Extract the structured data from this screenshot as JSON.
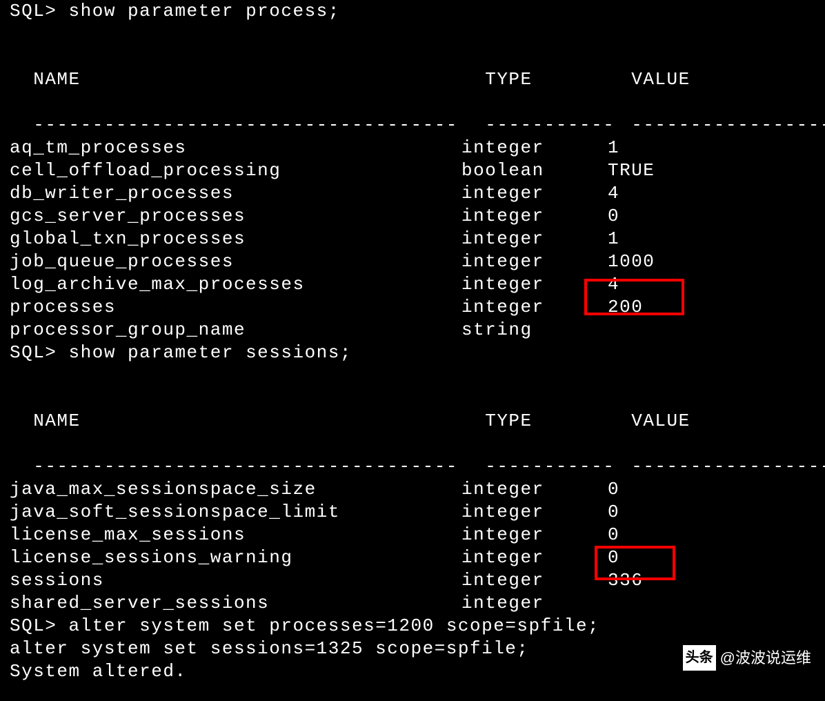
{
  "prompt": "SQL>",
  "commands": {
    "cmd1": "show parameter process;",
    "cmd2": "show parameter sessions;",
    "cmd3": "alter system set processes=1200 scope=spfile;",
    "cmd4": "alter system set sessions=1325 scope=spfile;",
    "result": "System altered."
  },
  "headers": {
    "name": "NAME",
    "type": "TYPE",
    "value": "VALUE"
  },
  "divider": {
    "name": "------------------------------------",
    "type": "-----------",
    "value": "------------------"
  },
  "table1": [
    {
      "name": "aq_tm_processes",
      "type": "integer",
      "value": "1"
    },
    {
      "name": "cell_offload_processing",
      "type": "boolean",
      "value": "TRUE"
    },
    {
      "name": "db_writer_processes",
      "type": "integer",
      "value": "4"
    },
    {
      "name": "gcs_server_processes",
      "type": "integer",
      "value": "0"
    },
    {
      "name": "global_txn_processes",
      "type": "integer",
      "value": "1"
    },
    {
      "name": "job_queue_processes",
      "type": "integer",
      "value": "1000"
    },
    {
      "name": "log_archive_max_processes",
      "type": "integer",
      "value": "4"
    },
    {
      "name": "processes",
      "type": "integer",
      "value": "200"
    },
    {
      "name": "processor_group_name",
      "type": "string",
      "value": ""
    }
  ],
  "table2": [
    {
      "name": "java_max_sessionspace_size",
      "type": "integer",
      "value": "0"
    },
    {
      "name": "java_soft_sessionspace_limit",
      "type": "integer",
      "value": "0"
    },
    {
      "name": "license_max_sessions",
      "type": "integer",
      "value": "0"
    },
    {
      "name": "license_sessions_warning",
      "type": "integer",
      "value": "0"
    },
    {
      "name": "sessions",
      "type": "integer",
      "value": "336"
    },
    {
      "name": "shared_server_sessions",
      "type": "integer",
      "value": ""
    }
  ],
  "watermark": {
    "badge": "头条",
    "text": "@波波说运维"
  }
}
